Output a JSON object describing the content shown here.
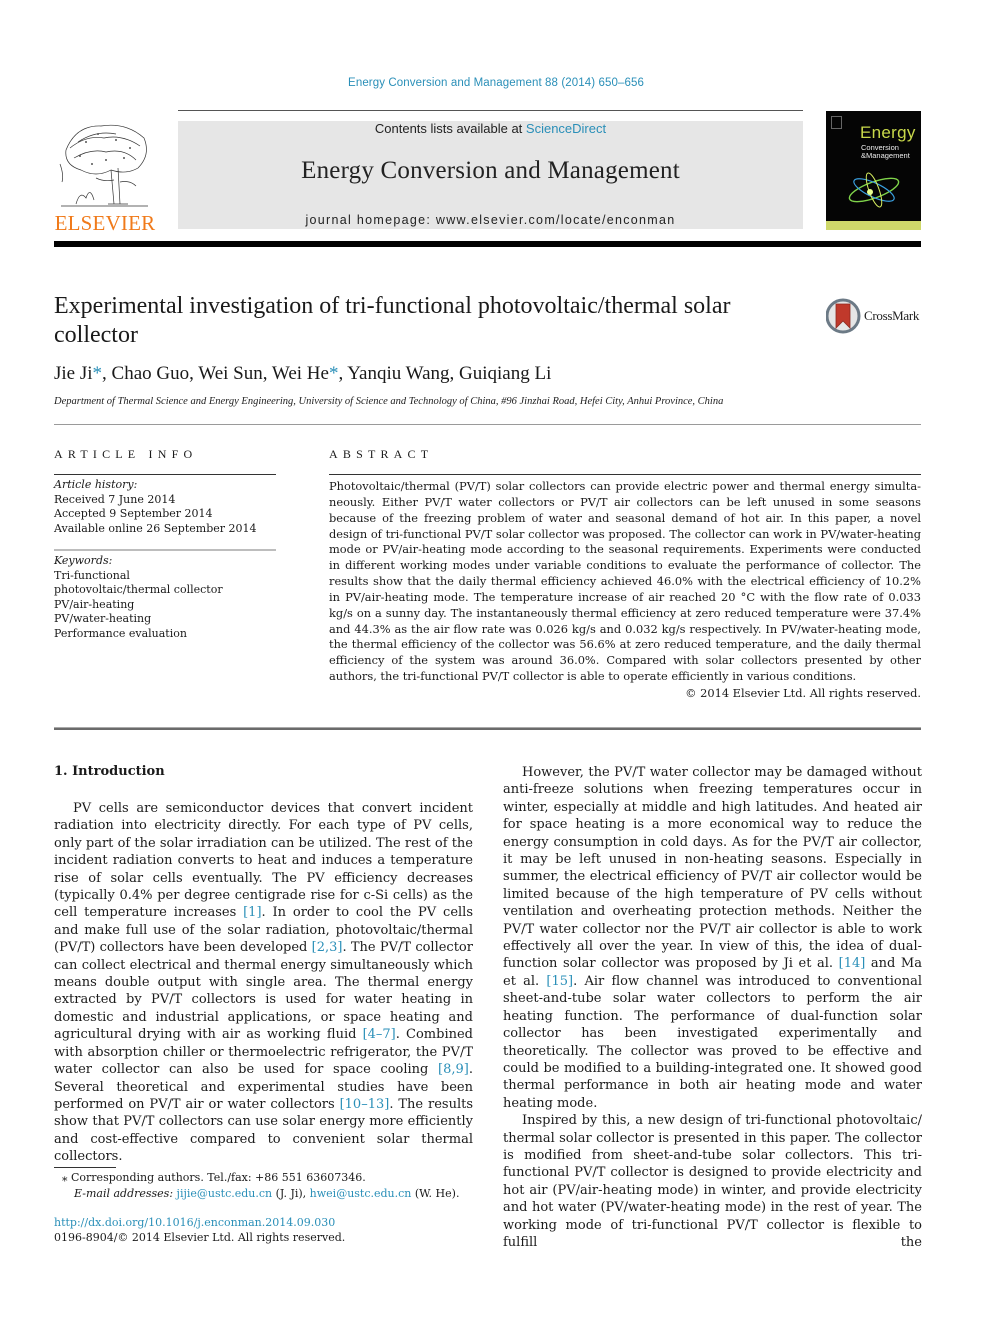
{
  "header": {
    "journal_ref": "Energy Conversion and Management 88 (2014) 650–656",
    "contents_prefix": "Contents lists available at ",
    "contents_link": "ScienceDirect",
    "journal_title": "Energy Conversion and Management",
    "homepage_prefix": "journal homepage: ",
    "homepage_url": "www.elsevier.com/locate/enconman",
    "publisher_logo": "ELSEVIER",
    "cover": {
      "title": "Energy",
      "subtitle_line1": "Conversion",
      "subtitle_line2": "&Management"
    },
    "colors": {
      "link": "#2a8fb8",
      "elsevier_orange": "#f07a1a",
      "banner_grey": "#e6e6e6"
    }
  },
  "article": {
    "title": "Experimental investigation of tri-functional photovoltaic/thermal solar collector",
    "crossmark_label": "CrossMark",
    "authors": [
      {
        "name": "Jie Ji",
        "corresponding": true
      },
      {
        "name": "Chao Guo",
        "corresponding": false
      },
      {
        "name": "Wei Sun",
        "corresponding": false
      },
      {
        "name": "Wei He",
        "corresponding": true
      },
      {
        "name": "Yanqiu Wang",
        "corresponding": false
      },
      {
        "name": "Guiqiang Li",
        "corresponding": false
      }
    ],
    "affiliation": "Department of Thermal Science and Energy Engineering, University of Science and Technology of China, #96 Jinzhai Road, Hefei City, Anhui Province, China"
  },
  "article_info": {
    "heading": "ARTICLE INFO",
    "history_label": "Article history:",
    "history": [
      "Received 7 June 2014",
      "Accepted 9 September 2014",
      "Available online 26 September 2014"
    ],
    "keywords_label": "Keywords:",
    "keywords": [
      "Tri-functional photovoltaic/thermal collector",
      "PV/air-heating",
      "PV/water-heating",
      "Performance evaluation"
    ]
  },
  "abstract": {
    "heading": "ABSTRACT",
    "text": "Photovoltaic/thermal (PV/T) solar collectors can provide electric power and thermal energy simulta­neously. Either PV/T water collectors or PV/T air collectors can be left unused in some seasons because of the freezing problem of water and seasonal demand of hot air. In this paper, a novel design of tri-func­tional PV/T solar collector was proposed. The collector can work in PV/water-heating mode or PV/air-heating mode according to the seasonal requirements. Experiments were conducted in different working modes under variable conditions to evaluate the performance of collector. The results show that the daily thermal efficiency achieved 46.0% with the electrical efficiency of 10.2% in PV/air-heating mode. The tem­perature increase of air reached 20 °C with the flow rate of 0.033 kg/s on a sunny day. The instanta­neously thermal efficiency at zero reduced temperature were 37.4% and 44.3% as the air flow rate was 0.026 kg/s and 0.032 kg/s respectively. In PV/water-heating mode, the thermal efficiency of the collector was 56.6% at zero reduced temperature, and the daily thermal efficiency of the system was around 36.0%. Compared with solar collectors presented by other authors, the tri-functional PV/T collector is able to operate efficiently in various conditions.",
    "copyright": "© 2014 Elsevier Ltd. All rights reserved."
  },
  "body": {
    "section_heading": "1. Introduction",
    "left_paragraph": [
      {
        "t": "PV cells are semiconductor devices that convert incident radia­tion into electricity directly. For each type of PV cells, only part of the solar irradiation can be utilized. The rest of the incident radia­tion converts to heat and induces a temperature rise of solar cells eventually. The PV efficiency decreases (typically 0.4% per degree centigrade rise for c-Si cells) as the cell temperature increases "
      },
      {
        "ref": "[1]"
      },
      {
        "t": ". In order to cool the PV cells and make full use of the solar radi­ation, photovoltaic/thermal (PV/T) collectors have been developed "
      },
      {
        "ref": "[2,3]"
      },
      {
        "t": ". The PV/T collector can collect electrical and thermal energy simultaneously which means double output with single area. The thermal energy extracted by PV/T collectors is used for water heating in domestic and industrial applications, or space heating and agricultural drying with air as working fluid "
      },
      {
        "ref": "[4–7]"
      },
      {
        "t": ". Combined with absorption chiller or thermoelectric refrigerator, the PV/T water collector can also be used for space cooling "
      },
      {
        "ref": "[8,9]"
      },
      {
        "t": ". Several the­oretical and experimental studies have been performed on PV/T air or water collectors "
      },
      {
        "ref": "[10–13]"
      },
      {
        "t": ". The results show that PV/T collectors can use solar energy more efficiently and cost-effective compared to convenient solar thermal collectors."
      }
    ],
    "right_paragraph_1": [
      {
        "t": "However, the PV/T water collector may be damaged without anti-freeze solutions when freezing temperatures occur in winter, especially at middle and high latitudes. And heated air for space heating is a more economical way to reduce the energy consump­tion in cold days. As for the PV/T air collector, it may be left unused in non-heating seasons. Especially in summer, the electrical effi­ciency of PV/T air collector would be limited because of the high temperature of PV cells without ventilation and overheating pro­tection methods. Neither the PV/T water collector nor the PV/T air collector is able to work effectively all over the year. In view of this, the idea of dual-function solar collector was proposed by Ji et al. "
      },
      {
        "ref": "[14]"
      },
      {
        "t": " and Ma et al. "
      },
      {
        "ref": "[15]"
      },
      {
        "t": ". Air flow channel was introduced to conventional sheet-and-tube solar water collectors to perform the air heating function. The performance of dual-function solar collector has been investigated experimentally and theoretically. The collector was proved to be effective and could be modified to a building-integrated one. It showed good thermal performance in both air heating mode and water heating mode."
      }
    ],
    "right_paragraph_2": "Inspired by this, a new design of tri-functional photovoltaic/ thermal solar collector is presented in this paper. The collector is modified from sheet-and-tube solar collectors. This tri-functional PV/T collector is designed to provide electricity and hot air (PV/air-heating mode) in winter, and provide electricity and hot water (PV/water-heating mode) in the rest of year. The working mode of tri-functional PV/T collector is flexible to fulfill the"
  },
  "footer": {
    "footnote_star": "⁎",
    "footnote_text": "Corresponding authors. Tel./fax: +86 551 63607346.",
    "email_label": "E-mail addresses:",
    "email_1": "jijie@ustc.edu.cn",
    "email_1_who": " (J. Ji), ",
    "email_2": "hwei@ustc.edu.cn",
    "email_2_who": " (W. He).",
    "doi": "http://dx.doi.org/10.1016/j.enconman.2014.09.030",
    "issn_line": "0196-8904/© 2014 Elsevier Ltd. All rights reserved."
  }
}
